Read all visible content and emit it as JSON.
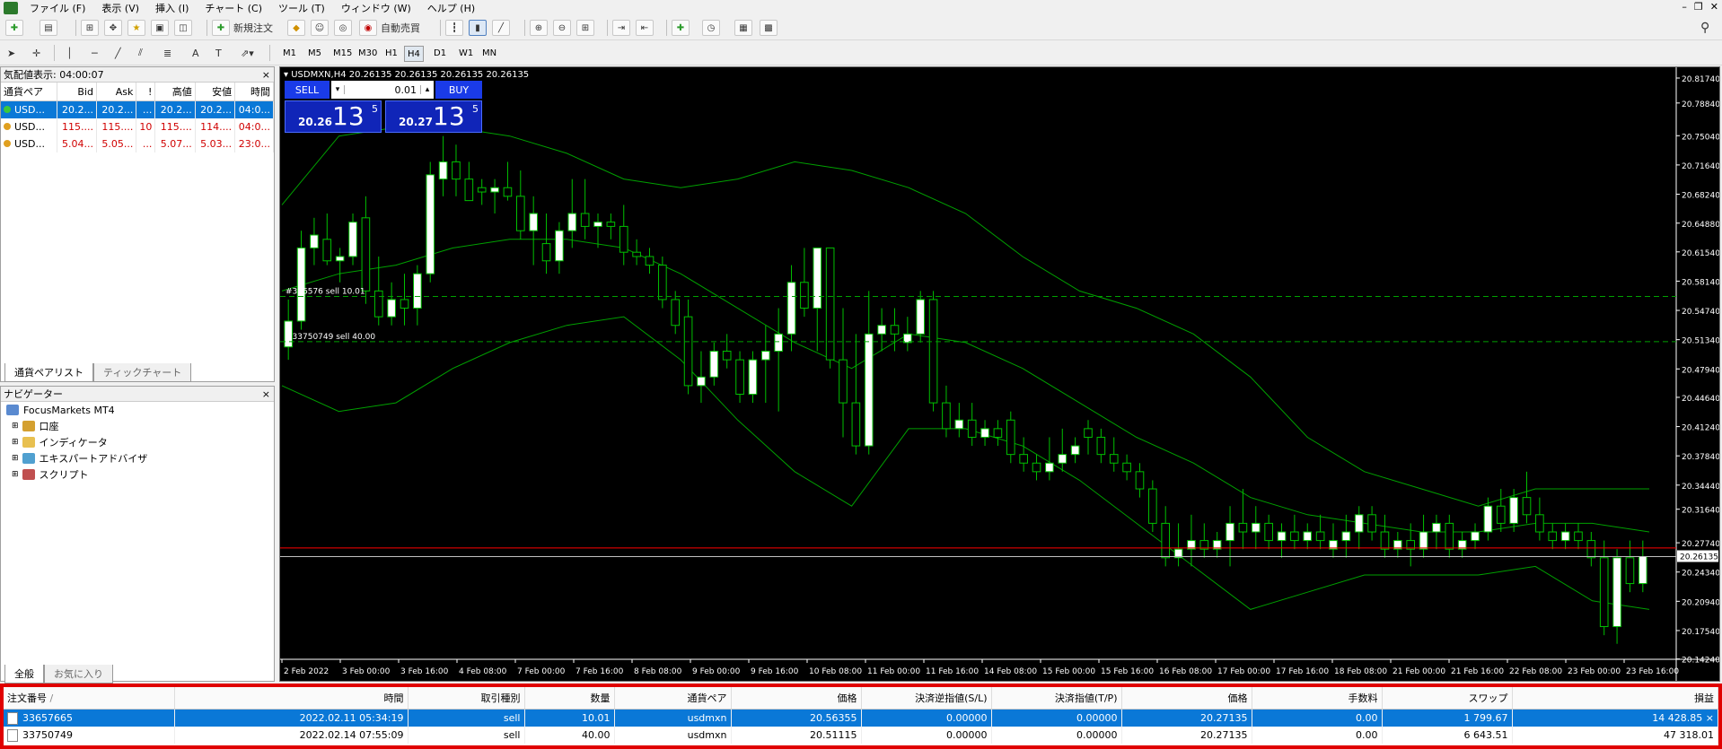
{
  "menu": [
    "ファイル (F)",
    "表示 (V)",
    "挿入 (I)",
    "チャート (C)",
    "ツール (T)",
    "ウィンドウ (W)",
    "ヘルプ (H)"
  ],
  "toolbar": {
    "new_order": "新規注文",
    "auto_trade": "自動売買"
  },
  "timeframes": [
    "M1",
    "M5",
    "M15",
    "M30",
    "H1",
    "H4",
    "D1",
    "W1",
    "MN"
  ],
  "active_timeframe": "H4",
  "market_watch": {
    "title": "気配値表示: 04:00:07",
    "columns": [
      "通貨ペア",
      "Bid",
      "Ask",
      "!",
      "高値",
      "安値",
      "時間"
    ],
    "rows": [
      {
        "symbol": "USD...",
        "bid": "20.2...",
        "ask": "20.2...",
        "spread": "...",
        "high": "20.2...",
        "low": "20.2...",
        "time": "04:0...",
        "selected": true,
        "icon_color": "#3cc83c"
      },
      {
        "symbol": "USD...",
        "bid": "115....",
        "ask": "115....",
        "spread": "10",
        "high": "115....",
        "low": "114....",
        "time": "04:0...",
        "selected": false,
        "icon_color": "#e0a020"
      },
      {
        "symbol": "USD...",
        "bid": "5.04...",
        "ask": "5.05...",
        "spread": "...",
        "high": "5.07...",
        "low": "5.03...",
        "time": "23:0...",
        "selected": false,
        "icon_color": "#e0a020"
      }
    ],
    "tabs": [
      "通貨ペアリスト",
      "ティックチャート"
    ]
  },
  "navigator": {
    "title": "ナビゲーター",
    "root": "FocusMarkets MT4",
    "items": [
      "口座",
      "インディケータ",
      "エキスパートアドバイザ",
      "スクリプト"
    ],
    "tabs": [
      "全般",
      "お気に入り"
    ]
  },
  "chart": {
    "header": "USDMXN,H4  20.26135 20.26135 20.26135 20.26135",
    "trade_panel": {
      "sell": "SELL",
      "buy": "BUY",
      "lot": "0.01",
      "bid_small": "20.26",
      "bid_big": "13",
      "bid_sup": "5",
      "ask_small": "20.27",
      "ask_big": "13",
      "ask_sup": "5"
    },
    "order_lines": [
      {
        "label": "#336576 sell 10.01",
        "price": 20.56355
      },
      {
        "label": "#33750749 sell 40.00",
        "price": 20.51115
      }
    ],
    "current_price": "20.26135",
    "price_axis": [
      "20.81740",
      "20.78840",
      "20.75040",
      "20.71640",
      "20.68240",
      "20.64880",
      "20.61540",
      "20.58140",
      "20.54740",
      "20.51340",
      "20.47940",
      "20.44640",
      "20.41240",
      "20.37840",
      "20.34440",
      "20.31640",
      "20.27740",
      "20.24340",
      "20.20940",
      "20.17540",
      "20.14240"
    ],
    "time_axis": [
      "2 Feb 2022",
      "3 Feb 00:00",
      "3 Feb 16:00",
      "4 Feb 08:00",
      "7 Feb 00:00",
      "7 Feb 16:00",
      "8 Feb 08:00",
      "9 Feb 00:00",
      "9 Feb 16:00",
      "10 Feb 08:00",
      "11 Feb 00:00",
      "11 Feb 16:00",
      "14 Feb 08:00",
      "15 Feb 00:00",
      "15 Feb 16:00",
      "16 Feb 08:00",
      "17 Feb 00:00",
      "17 Feb 16:00",
      "18 Feb 08:00",
      "21 Feb 00:00",
      "21 Feb 16:00",
      "22 Feb 08:00",
      "23 Feb 00:00",
      "23 Feb 16:00"
    ]
  },
  "chart_data": {
    "type": "candlestick",
    "ylim": [
      20.142,
      20.8174
    ],
    "candles": [
      [
        20.505,
        20.56,
        20.49,
        20.535
      ],
      [
        20.535,
        20.64,
        20.525,
        20.62
      ],
      [
        20.62,
        20.655,
        20.6,
        20.635
      ],
      [
        20.63,
        20.66,
        20.6,
        20.605
      ],
      [
        20.605,
        20.62,
        20.58,
        20.61
      ],
      [
        20.61,
        20.66,
        20.6,
        20.65
      ],
      [
        20.655,
        20.68,
        20.555,
        20.57
      ],
      [
        20.57,
        20.61,
        20.53,
        20.54
      ],
      [
        20.54,
        20.58,
        20.53,
        20.56
      ],
      [
        20.56,
        20.59,
        20.53,
        20.55
      ],
      [
        20.55,
        20.6,
        20.53,
        20.59
      ],
      [
        20.59,
        20.72,
        20.58,
        20.705
      ],
      [
        20.7,
        20.75,
        20.68,
        20.72
      ],
      [
        20.72,
        20.74,
        20.68,
        20.7
      ],
      [
        20.7,
        20.72,
        20.68,
        20.675
      ],
      [
        20.69,
        20.7,
        20.67,
        20.685
      ],
      [
        20.685,
        20.7,
        20.66,
        20.69
      ],
      [
        20.69,
        20.72,
        20.675,
        20.68
      ],
      [
        20.68,
        20.71,
        20.63,
        20.64
      ],
      [
        20.64,
        20.68,
        20.6,
        20.66
      ],
      [
        20.625,
        20.66,
        20.59,
        20.605
      ],
      [
        20.605,
        20.65,
        20.59,
        20.64
      ],
      [
        20.64,
        20.7,
        20.62,
        20.66
      ],
      [
        20.66,
        20.7,
        20.63,
        20.645
      ],
      [
        20.645,
        20.66,
        20.62,
        20.65
      ],
      [
        20.65,
        20.66,
        20.63,
        20.645
      ],
      [
        20.645,
        20.67,
        20.6,
        20.615
      ],
      [
        20.615,
        20.63,
        20.6,
        20.61
      ],
      [
        20.61,
        20.62,
        20.59,
        20.6
      ],
      [
        20.6,
        20.61,
        20.55,
        20.56
      ],
      [
        20.56,
        20.57,
        20.52,
        20.53
      ],
      [
        20.54,
        20.56,
        20.45,
        20.46
      ],
      [
        20.46,
        20.5,
        20.44,
        20.47
      ],
      [
        20.47,
        20.51,
        20.46,
        20.5
      ],
      [
        20.5,
        20.52,
        20.48,
        20.49
      ],
      [
        20.49,
        20.5,
        20.44,
        20.45
      ],
      [
        20.45,
        20.5,
        20.44,
        20.49
      ],
      [
        20.49,
        20.53,
        20.44,
        20.5
      ],
      [
        20.5,
        20.55,
        20.43,
        20.52
      ],
      [
        20.52,
        20.6,
        20.5,
        20.58
      ],
      [
        20.58,
        20.62,
        20.54,
        20.55
      ],
      [
        20.55,
        20.62,
        20.5,
        20.62
      ],
      [
        20.62,
        20.62,
        20.48,
        20.49
      ],
      [
        20.49,
        20.55,
        20.4,
        20.44
      ],
      [
        20.44,
        20.52,
        20.38,
        20.39
      ],
      [
        20.39,
        20.57,
        20.38,
        20.52
      ],
      [
        20.52,
        20.55,
        20.5,
        20.53
      ],
      [
        20.53,
        20.55,
        20.5,
        20.52
      ],
      [
        20.51,
        20.54,
        20.5,
        20.52
      ],
      [
        20.52,
        20.57,
        20.51,
        20.56
      ],
      [
        20.56,
        20.57,
        20.43,
        20.44
      ],
      [
        20.44,
        20.46,
        20.4,
        20.41
      ],
      [
        20.41,
        20.44,
        20.4,
        20.42
      ],
      [
        20.42,
        20.44,
        20.39,
        20.4
      ],
      [
        20.4,
        20.42,
        20.39,
        20.41
      ],
      [
        20.41,
        20.42,
        20.39,
        20.4
      ],
      [
        20.42,
        20.43,
        20.37,
        20.38
      ],
      [
        20.38,
        20.4,
        20.36,
        20.37
      ],
      [
        20.37,
        20.38,
        20.35,
        20.36
      ],
      [
        20.36,
        20.4,
        20.35,
        20.37
      ],
      [
        20.37,
        20.41,
        20.36,
        20.38
      ],
      [
        20.38,
        20.4,
        20.37,
        20.39
      ],
      [
        20.41,
        20.42,
        20.38,
        20.4
      ],
      [
        20.4,
        20.41,
        20.37,
        20.38
      ],
      [
        20.38,
        20.4,
        20.36,
        20.37
      ],
      [
        20.37,
        20.38,
        20.35,
        20.36
      ],
      [
        20.36,
        20.37,
        20.33,
        20.34
      ],
      [
        20.34,
        20.35,
        20.29,
        20.3
      ],
      [
        20.3,
        20.32,
        20.25,
        20.26
      ],
      [
        20.26,
        20.3,
        20.25,
        20.27
      ],
      [
        20.27,
        20.31,
        20.25,
        20.28
      ],
      [
        20.28,
        20.3,
        20.26,
        20.27
      ],
      [
        20.27,
        20.29,
        20.26,
        20.28
      ],
      [
        20.28,
        20.32,
        20.25,
        20.3
      ],
      [
        20.3,
        20.34,
        20.27,
        20.29
      ],
      [
        20.29,
        20.32,
        20.27,
        20.3
      ],
      [
        20.3,
        20.31,
        20.27,
        20.28
      ],
      [
        20.28,
        20.3,
        20.26,
        20.29
      ],
      [
        20.29,
        20.31,
        20.27,
        20.28
      ],
      [
        20.28,
        20.3,
        20.27,
        20.29
      ],
      [
        20.29,
        20.31,
        20.27,
        20.28
      ],
      [
        20.27,
        20.3,
        20.26,
        20.28
      ],
      [
        20.28,
        20.31,
        20.26,
        20.29
      ],
      [
        20.29,
        20.32,
        20.27,
        20.31
      ],
      [
        20.31,
        20.32,
        20.28,
        20.29
      ],
      [
        20.29,
        20.31,
        20.26,
        20.27
      ],
      [
        20.27,
        20.29,
        20.26,
        20.28
      ],
      [
        20.28,
        20.3,
        20.25,
        20.27
      ],
      [
        20.27,
        20.31,
        20.26,
        20.29
      ],
      [
        20.29,
        20.31,
        20.27,
        20.3
      ],
      [
        20.3,
        20.31,
        20.26,
        20.27
      ],
      [
        20.27,
        20.29,
        20.26,
        20.28
      ],
      [
        20.28,
        20.3,
        20.27,
        20.29
      ],
      [
        20.29,
        20.33,
        20.28,
        20.32
      ],
      [
        20.32,
        20.34,
        20.29,
        20.3
      ],
      [
        20.3,
        20.34,
        20.29,
        20.33
      ],
      [
        20.33,
        20.36,
        20.3,
        20.31
      ],
      [
        20.31,
        20.33,
        20.28,
        20.29
      ],
      [
        20.29,
        20.3,
        20.27,
        20.28
      ],
      [
        20.28,
        20.3,
        20.27,
        20.29
      ],
      [
        20.29,
        20.3,
        20.27,
        20.28
      ],
      [
        20.28,
        20.29,
        20.25,
        20.26
      ],
      [
        20.26,
        20.28,
        20.17,
        20.18
      ],
      [
        20.18,
        20.27,
        20.16,
        20.26
      ],
      [
        20.26,
        20.28,
        20.22,
        20.23
      ],
      [
        20.23,
        20.28,
        20.22,
        20.26135
      ]
    ],
    "bands": {
      "upper": [
        20.67,
        20.75,
        20.76,
        20.76,
        20.75,
        20.73,
        20.7,
        20.69,
        20.7,
        20.72,
        20.71,
        20.69,
        20.66,
        20.61,
        20.57,
        20.55,
        20.52,
        20.47,
        20.4,
        20.36,
        20.34,
        20.32,
        20.34,
        20.34,
        20.34
      ],
      "middle": [
        20.57,
        20.59,
        20.6,
        20.62,
        20.63,
        20.63,
        20.62,
        20.59,
        20.55,
        20.51,
        20.48,
        20.52,
        20.51,
        20.48,
        20.44,
        20.4,
        20.37,
        20.33,
        20.31,
        20.3,
        20.29,
        20.29,
        20.3,
        20.3,
        20.29
      ],
      "lower": [
        20.46,
        20.43,
        20.44,
        20.48,
        20.51,
        20.53,
        20.54,
        20.49,
        20.42,
        20.36,
        20.32,
        20.41,
        20.41,
        20.39,
        20.35,
        20.3,
        20.25,
        20.2,
        20.22,
        20.24,
        20.24,
        20.24,
        20.25,
        20.21,
        20.2
      ]
    }
  },
  "terminal": {
    "columns": [
      "注文番号",
      "時間",
      "取引種別",
      "数量",
      "通貨ペア",
      "価格",
      "決済逆指値(S/L)",
      "決済指値(T/P)",
      "価格",
      "手数料",
      "スワップ",
      "損益"
    ],
    "rows": [
      {
        "id": "33657665",
        "time": "2022.02.11 05:34:19",
        "type": "sell",
        "volume": "10.01",
        "symbol": "usdmxn",
        "price": "20.56355",
        "sl": "0.00000",
        "tp": "0.00000",
        "cur": "20.27135",
        "commission": "0.00",
        "swap": "1 799.67",
        "profit": "14 428.85",
        "selected": true
      },
      {
        "id": "33750749",
        "time": "2022.02.14 07:55:09",
        "type": "sell",
        "volume": "40.00",
        "symbol": "usdmxn",
        "price": "20.51115",
        "sl": "0.00000",
        "tp": "0.00000",
        "cur": "20.27135",
        "commission": "0.00",
        "swap": "6 643.51",
        "profit": "47 318.01",
        "selected": false
      }
    ]
  },
  "colors": {
    "bull": "#ffffff",
    "bear": "#000000",
    "wick": "#00c000",
    "bands": "#00a000",
    "order_line": "#00a000",
    "bid_line": "#ff0000",
    "ask_line": "#c0c0c0",
    "selection": "#0a78d7"
  }
}
